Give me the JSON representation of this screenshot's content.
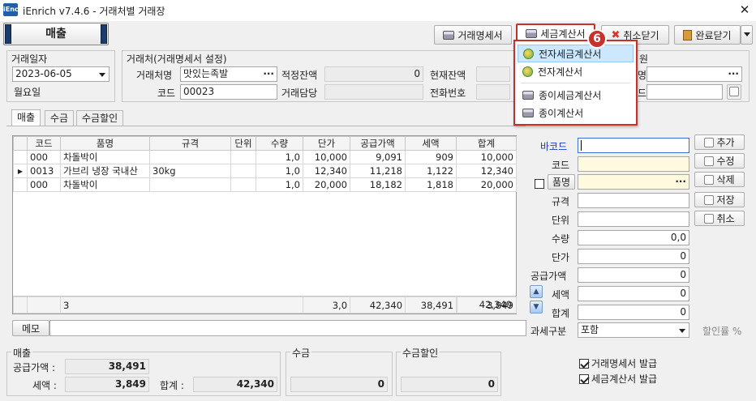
{
  "window": {
    "title": "iEnrich v7.4.6 - 거래처별 거래장",
    "app_icon": "iEnc",
    "close": "✕"
  },
  "toolbar": {
    "statement": "거래명세서",
    "tax_invoice": "세금계산서",
    "cancel_close": "취소닫기",
    "complete_close": "완료닫기"
  },
  "sales_tab": "매출",
  "trade_date": {
    "label": "거래일자",
    "value": "2023-06-05",
    "weekday": "월요일"
  },
  "partner": {
    "group_label": "거래처(거래명세서 설정)",
    "name_label": "거래처명",
    "name_value": "맛있는족발",
    "code_label": "코드",
    "code_value": "00023",
    "balance_label": "적정잔액",
    "balance_value": "0",
    "manager_label": "거래담당",
    "current_balance_label": "현재잔액",
    "phone_label": "전화번호"
  },
  "right_group": {
    "label": "원",
    "field1_label": "명",
    "field2_label": "드"
  },
  "tabs": [
    "매출",
    "수금",
    "수금할인"
  ],
  "grid": {
    "columns": [
      "코드",
      "품명",
      "규격",
      "단위",
      "수량",
      "단가",
      "공급가액",
      "세액",
      "합계"
    ],
    "rows": [
      [
        "000",
        "차돌박이",
        "",
        "",
        "1,0",
        "10,000",
        "9,091",
        "909",
        "10,000"
      ],
      [
        "0013",
        "가브리 냉장 국내산",
        "30kg",
        "",
        "1,0",
        "12,340",
        "11,218",
        "1,122",
        "12,340"
      ],
      [
        "000",
        "차돌박이",
        "",
        "",
        "1,0",
        "20,000",
        "18,182",
        "1,818",
        "20,000"
      ]
    ],
    "footer": {
      "count": "3",
      "qty": "3,0",
      "price": "42,340",
      "supply": "38,491",
      "tax": "3,849",
      "total": "42,340"
    }
  },
  "memo_label": "메모",
  "form": {
    "barcode": "바코드",
    "code": "코드",
    "item": "품명",
    "spec": "규격",
    "unit": "단위",
    "qty": "수량",
    "qty_value": "0,0",
    "price": "단가",
    "price_value": "0",
    "supply": "공급가액",
    "supply_value": "0",
    "tax": "세액",
    "tax_value": "0",
    "total": "합계",
    "total_value": "0",
    "tax_type_label": "과세구분",
    "tax_type_value": "포함",
    "discount_label": "할인률 %"
  },
  "side_buttons": {
    "add": "추가",
    "edit": "수정",
    "delete": "삭제",
    "save": "저장",
    "cancel": "취소"
  },
  "summary": {
    "sales_label": "매출",
    "supply_label": "공급가액 :",
    "supply_value": "38,491",
    "tax_label": "세액 :",
    "tax_value": "3,849",
    "total_label": "합계 :",
    "total_value": "42,340",
    "collect_label": "수금",
    "collect_value": "0",
    "discount_label": "수금할인",
    "discount_value": "0"
  },
  "issue": {
    "statement": "거래명세서 발급",
    "tax_invoice": "세금계산서 발급"
  },
  "dropdown": {
    "items": [
      "전자세금계산서",
      "전자계산서",
      "종이세금계산서",
      "종이계산서"
    ],
    "badge": "6"
  },
  "colors": {
    "accent_red": "#c8302c",
    "highlight": "#cce8ff",
    "barcode_blue": "#1a3fb0"
  }
}
